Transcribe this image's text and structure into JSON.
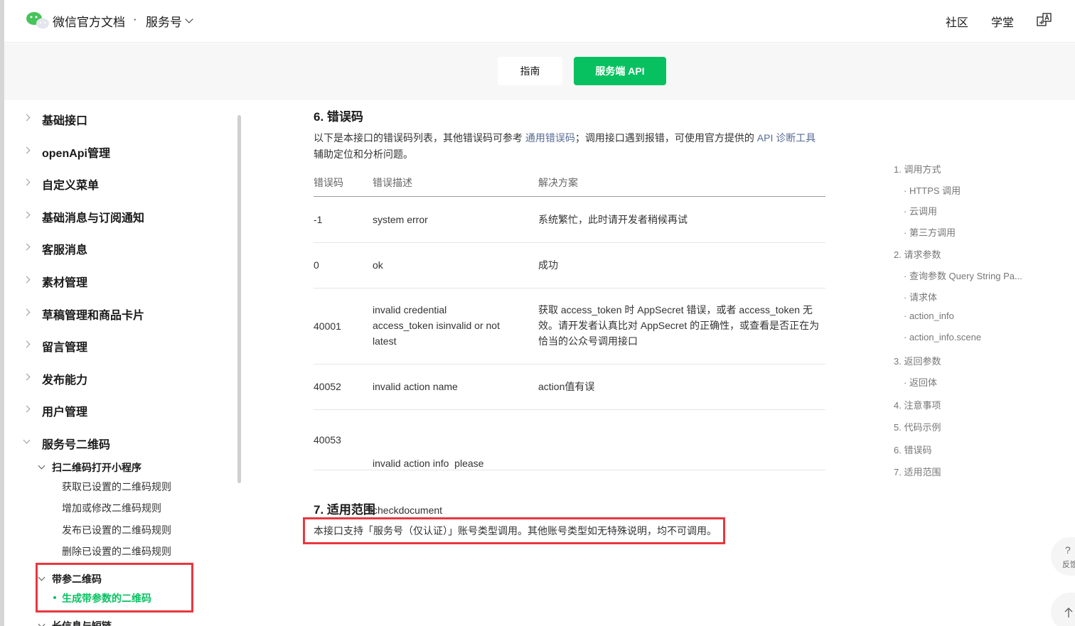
{
  "header": {
    "brand": "微信官方文档",
    "separator": "·",
    "product": "服务号",
    "nav": [
      "社区",
      "学堂"
    ]
  },
  "tabs": {
    "guide": "指南",
    "api": "服务端 API"
  },
  "sidebar": {
    "items": [
      {
        "label": "基础接口"
      },
      {
        "label": "openApi管理"
      },
      {
        "label": "自定义菜单"
      },
      {
        "label": "基础消息与订阅通知"
      },
      {
        "label": "客服消息"
      },
      {
        "label": "素材管理"
      },
      {
        "label": "草稿管理和商品卡片"
      },
      {
        "label": "留言管理"
      },
      {
        "label": "发布能力"
      },
      {
        "label": "用户管理"
      },
      {
        "label": "服务号二维码"
      }
    ],
    "sub1": {
      "label": "扫二维码打开小程序",
      "leaves": [
        "获取已设置的二维码规则",
        "增加或修改二维码规则",
        "发布已设置的二维码规则",
        "删除已设置的二维码规则"
      ]
    },
    "sub2": {
      "label": "带参二维码",
      "active_leaf": "生成带参数的二维码"
    },
    "next_partial": "长信息与短链"
  },
  "content": {
    "section6_title": "6. 错误码",
    "intro_part1": "以下是本接口的错误码列表，其他错误码可参考 ",
    "intro_link1": "通用错误码",
    "intro_part2": "；调用接口遇到报错，可使用官方提供的 ",
    "intro_link2": "API 诊断工具",
    "intro_line2": "辅助定位和分析问题。",
    "table": {
      "headers": [
        "错误码",
        "错误描述",
        "解决方案"
      ],
      "rows": [
        {
          "code": "-1",
          "desc": "system error",
          "solution": "系统繁忙，此时请开发者稍候再试"
        },
        {
          "code": "0",
          "desc": "ok",
          "solution": "成功"
        },
        {
          "code": "40001",
          "desc_lines": [
            "invalid credential",
            "access_token isinvalid or not",
            "latest"
          ],
          "solution_lines": [
            "获取 access_token 时 AppSecret 错误，或者 access_token 无",
            "效。请开发者认真比对 AppSecret 的正确性，或查看是否正在为",
            "恰当的公众号调用接口"
          ]
        },
        {
          "code": "40052",
          "desc": "invalid action name",
          "solution": "action值有误"
        },
        {
          "code": "40053",
          "desc_lines": [
            "invalid action info  please",
            "checkdocument"
          ],
          "solution": ""
        }
      ]
    },
    "section7_title": "7. 适用范围",
    "section7_text": "本接口支持「服务号（仅认证）」账号类型调用。其他账号类型如无特殊说明，均不可调用。"
  },
  "toc": [
    {
      "label": "1. 调用方式",
      "level": 1
    },
    {
      "label": "· HTTPS 调用",
      "level": 2
    },
    {
      "label": "· 云调用",
      "level": 2
    },
    {
      "label": "· 第三方调用",
      "level": 2
    },
    {
      "label": "2. 请求参数",
      "level": 1
    },
    {
      "label": "· 查询参数 Query String Pa...",
      "level": 2
    },
    {
      "label": "· 请求体",
      "level": 2
    },
    {
      "label": "· action_info",
      "level": 2
    },
    {
      "label": "· action_info.scene",
      "level": 2
    },
    {
      "label": "3. 返回参数",
      "level": 1
    },
    {
      "label": "· 返回体",
      "level": 2
    },
    {
      "label": "4. 注意事项",
      "level": 1
    },
    {
      "label": "5. 代码示例",
      "level": 1
    },
    {
      "label": "6. 错误码",
      "level": 1
    },
    {
      "label": "7. 适用范围",
      "level": 1
    }
  ],
  "float": {
    "feedback_q": "?",
    "feedback_label": "反馈"
  },
  "colors": {
    "accent": "#07c160",
    "link": "#576b95",
    "highlight_box": "#e8373f"
  }
}
